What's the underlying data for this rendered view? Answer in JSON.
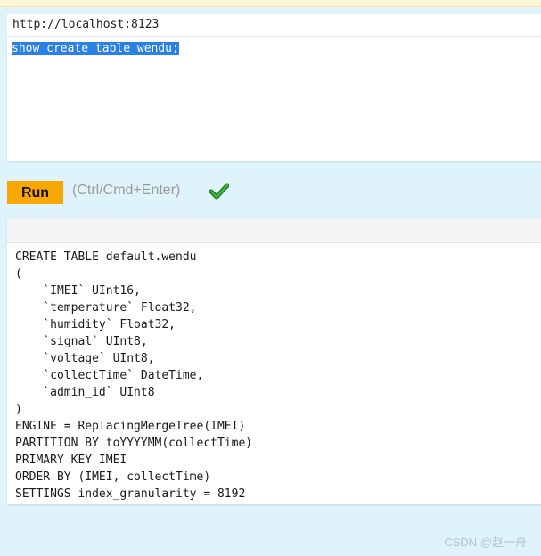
{
  "url": "http://localhost:8123",
  "query": "show create table wendu;",
  "run_label": "Run",
  "shortcut_hint": "(Ctrl/Cmd+Enter)",
  "status_icon": "check-icon",
  "colors": {
    "run_button": "#f8a800",
    "selection": "#2b80e6",
    "check": "#2e9b2e",
    "background": "#dff3fa"
  },
  "result_lines": [
    "CREATE TABLE default.wendu",
    "(",
    "    `IMEI` UInt16,",
    "    `temperature` Float32,",
    "    `humidity` Float32,",
    "    `signal` UInt8,",
    "    `voltage` UInt8,",
    "    `collectTime` DateTime,",
    "    `admin_id` UInt8",
    ")",
    "ENGINE = ReplacingMergeTree(IMEI)",
    "PARTITION BY toYYYYMM(collectTime)",
    "PRIMARY KEY IMEI",
    "ORDER BY (IMEI, collectTime)",
    "SETTINGS index_granularity = 8192"
  ],
  "watermark": "CSDN @赵一舟"
}
